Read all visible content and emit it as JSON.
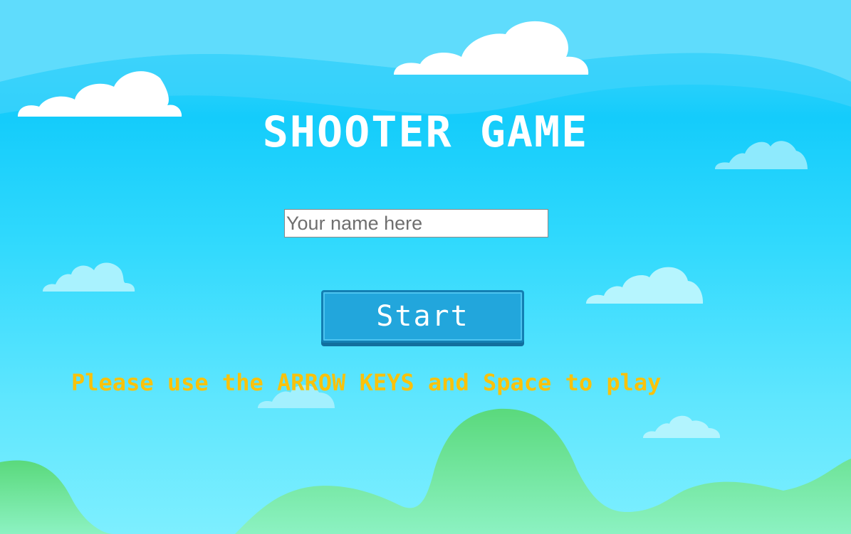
{
  "game": {
    "title": "SHOOTER GAME",
    "name_input": {
      "value": "",
      "placeholder": "Your name here"
    },
    "start_label": "Start",
    "instructions": "Please use the ARROW KEYS and Space to play"
  },
  "colors": {
    "title": "#ffffff",
    "instructions": "#f9c20b",
    "button_face": "#22a6dc",
    "hills": "#6ee495",
    "sky_top": "#56d8fb",
    "sky_bottom": "#7defff"
  }
}
